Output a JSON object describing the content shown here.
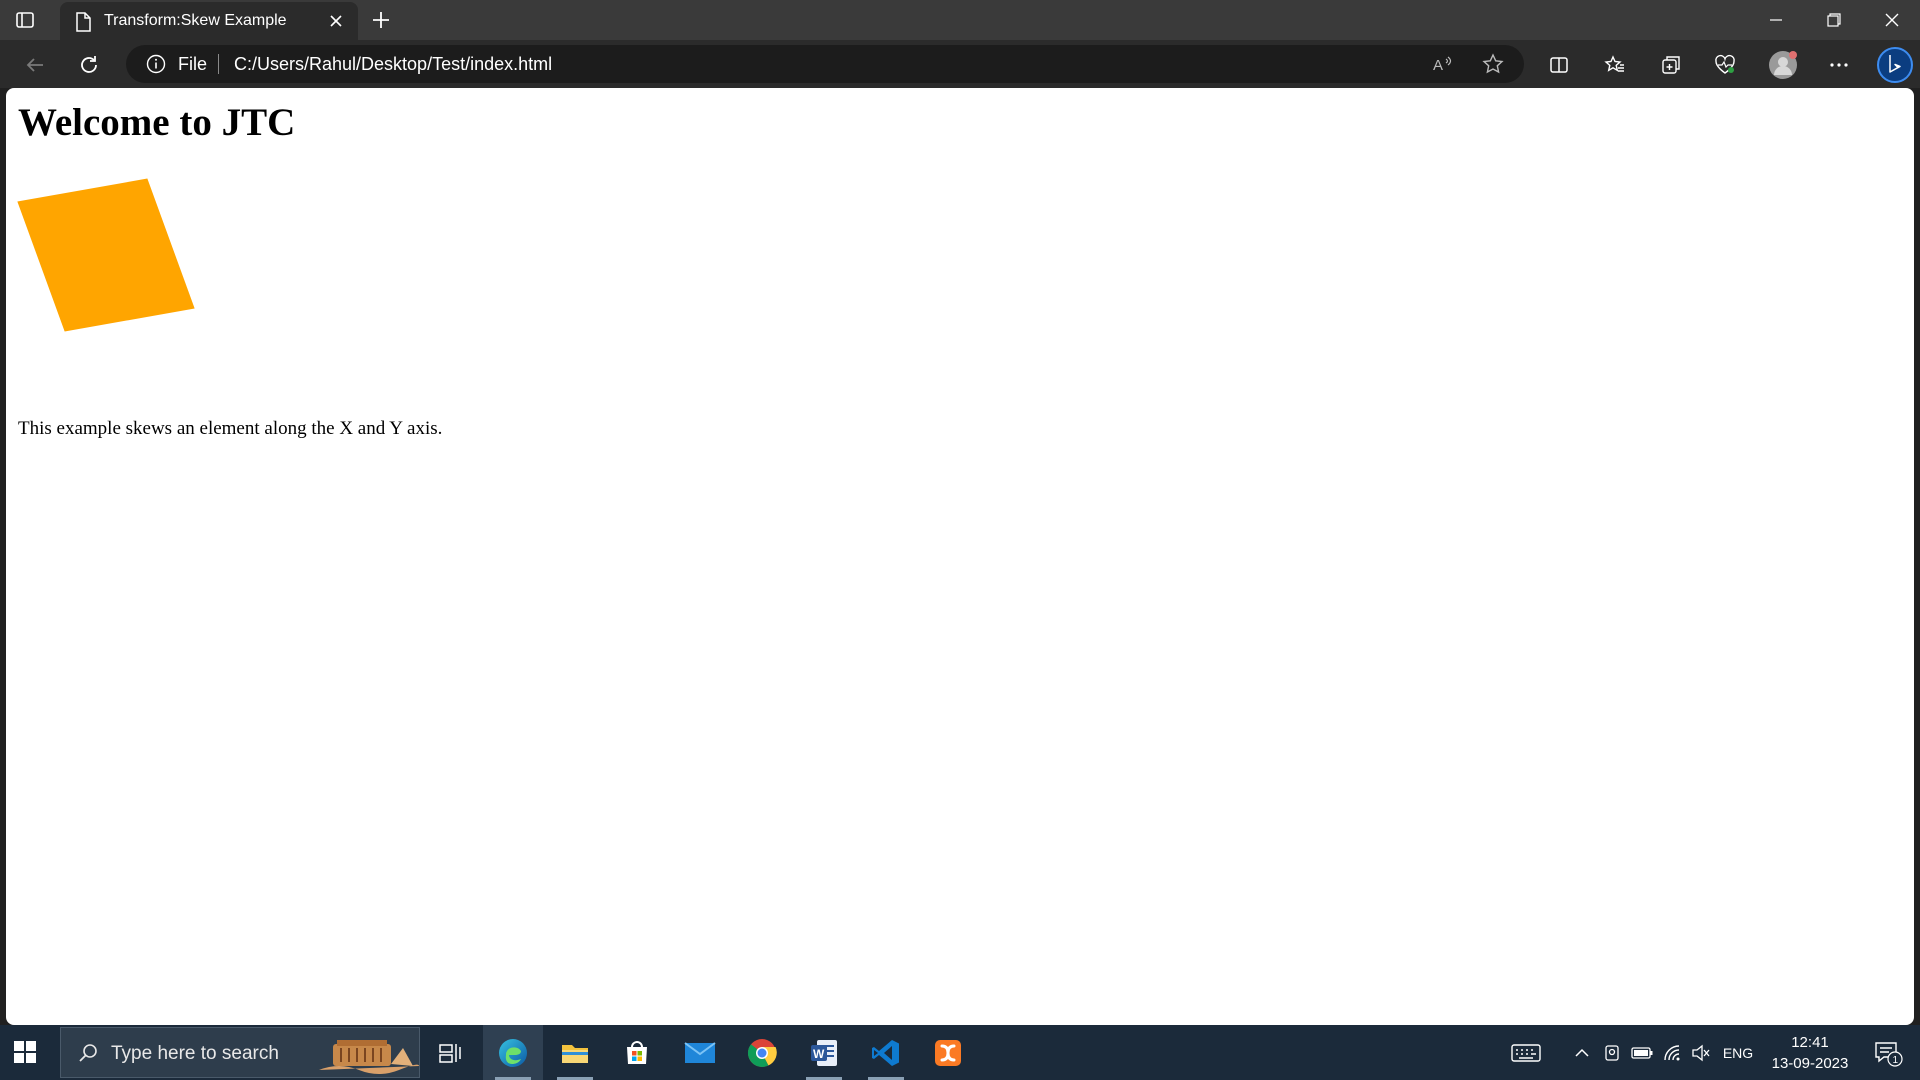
{
  "browser": {
    "tab": {
      "title": "Transform:Skew Example"
    },
    "address": {
      "scheme": "File",
      "url": "C:/Users/Rahul/Desktop/Test/index.html"
    }
  },
  "page": {
    "heading": "Welcome to JTC",
    "box_color": "#FFA500",
    "paragraph": "This example skews an element along the X and Y axis."
  },
  "taskbar": {
    "search_placeholder": "Type here to search",
    "language": "ENG",
    "time": "12:41",
    "date": "13-09-2023",
    "notification_count": "1",
    "apps": [
      "task-view",
      "edge",
      "file-explorer",
      "microsoft-store",
      "mail",
      "chrome",
      "word",
      "vscode",
      "xampp"
    ]
  }
}
